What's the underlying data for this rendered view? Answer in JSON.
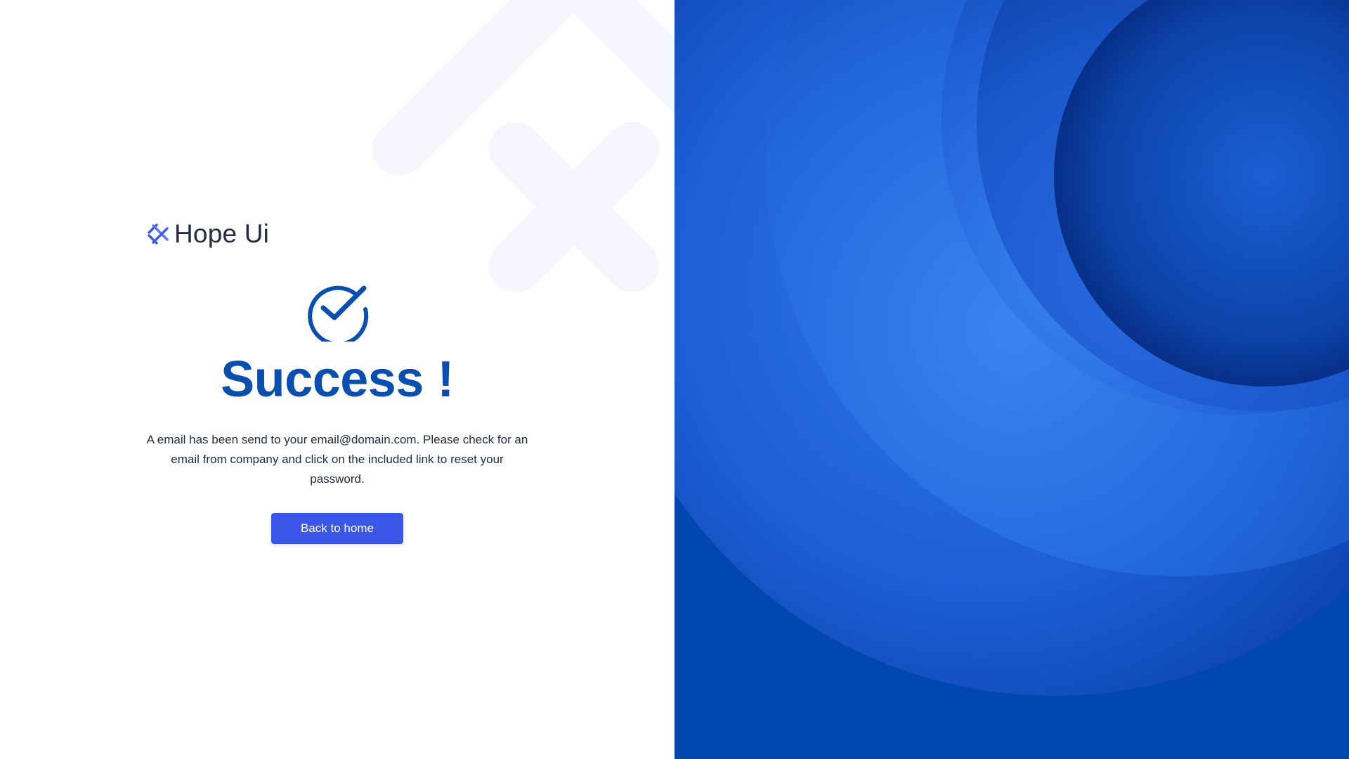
{
  "brand": {
    "name": "Hope Ui",
    "logo_icon": "hope-ui-logo-icon"
  },
  "status": {
    "icon": "check-circle-icon",
    "title": "Success !",
    "message": "A email has been send to your email@domain.com. Please check for an email from company and click on the included link to reset your password."
  },
  "actions": {
    "back_home_label": "Back to home"
  },
  "colors": {
    "primary": "#3a57e8",
    "title": "#0a4fb0",
    "text": "#232d42",
    "panel_blue": "#0048b0"
  }
}
